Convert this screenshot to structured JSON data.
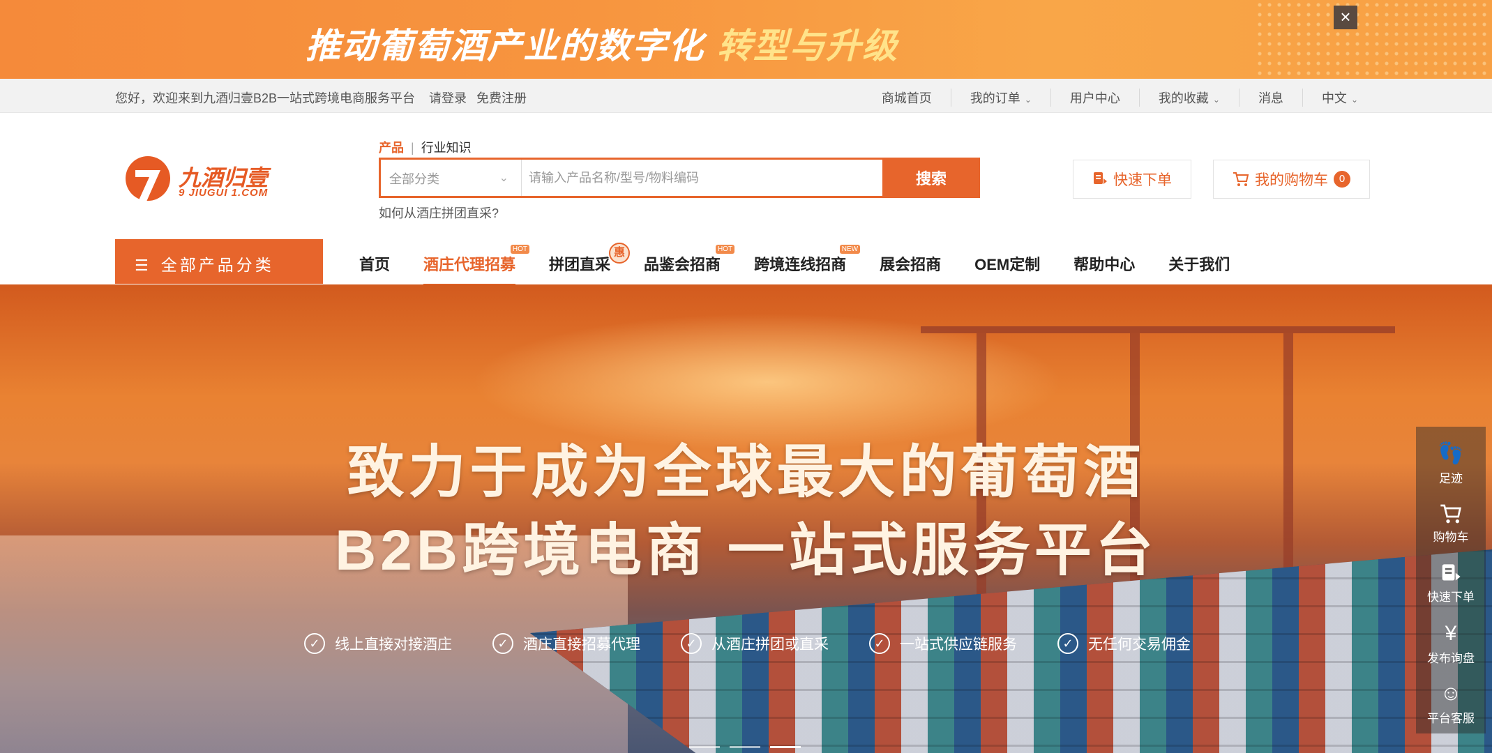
{
  "promo": {
    "title": "推动葡萄酒产业的数字化",
    "highlight": "转型与升级",
    "close_icon": "close-icon"
  },
  "topbar": {
    "welcome": "您好，欢迎来到九酒归壹B2B一站式跨境电商服务平台",
    "login": "请登录",
    "register": "免费注册",
    "links": [
      "商城首页",
      "我的订单",
      "用户中心",
      "我的收藏",
      "消息",
      "中文"
    ]
  },
  "logo": {
    "name": "九酒归壹",
    "domain": "9 JIUGUI 1.COM"
  },
  "search": {
    "tab_product": "产品",
    "tab_knowledge": "行业知识",
    "category": "全部分类",
    "placeholder": "请输入产品名称/型号/物料编码",
    "button": "搜索",
    "hint": "如何从酒庄拼团直采?"
  },
  "header_actions": {
    "quick_order": "快速下单",
    "cart": "我的购物车",
    "cart_count": "0"
  },
  "nav": {
    "all_categories": "全部产品分类",
    "items": [
      {
        "label": "首页"
      },
      {
        "label": "酒庄代理招募",
        "badge": "HOT"
      },
      {
        "label": "拼团直采",
        "badge": "惠"
      },
      {
        "label": "品鉴会招商",
        "badge": "HOT"
      },
      {
        "label": "跨境连线招商",
        "badge": "NEW"
      },
      {
        "label": "展会招商"
      },
      {
        "label": "OEM定制"
      },
      {
        "label": "帮助中心"
      },
      {
        "label": "关于我们"
      }
    ]
  },
  "hero": {
    "line1": "致力于成为全球最大的葡萄酒",
    "line2": "B2B跨境电商  一站式服务平台",
    "features": [
      "线上直接对接酒庄",
      "酒庄直接招募代理",
      "从酒庄拼团或直采",
      "一站式供应链服务",
      "无任何交易佣金"
    ]
  },
  "sidebar": {
    "items": [
      {
        "label": "足迹",
        "icon": "footprint-icon"
      },
      {
        "label": "购物车",
        "icon": "cart-icon"
      },
      {
        "label": "快速下单",
        "icon": "quick-order-icon"
      },
      {
        "label": "发布询盘",
        "icon": "inquiry-icon"
      },
      {
        "label": "平台客服",
        "icon": "customer-service-icon"
      }
    ]
  },
  "colors": {
    "accent": "#e7652c",
    "promo_bg": "#f7953f",
    "hero_text": "#fff3e2"
  }
}
